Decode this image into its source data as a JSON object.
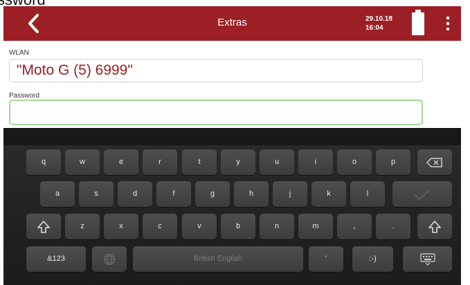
{
  "page_header_crop": "ssword",
  "appbar": {
    "title": "Extras",
    "date": "29.10.18",
    "time": "16:04",
    "background": "#9b1f24",
    "back_icon": "chevron-left-icon",
    "battery_icon": "battery-full-icon",
    "menu_icon": "more-vert-icon"
  },
  "form": {
    "wlan_label": "WLAN",
    "wlan_value": "\"Moto G (5) 6999\"",
    "password_label": "Password",
    "password_value": ""
  },
  "keyboard": {
    "row1": [
      "q",
      "w",
      "e",
      "r",
      "t",
      "y",
      "u",
      "i",
      "o",
      "p"
    ],
    "row2": [
      "a",
      "s",
      "d",
      "f",
      "g",
      "h",
      "j",
      "k",
      "l"
    ],
    "row3": [
      "z",
      "x",
      "c",
      "v",
      "b",
      "n",
      "m",
      ",",
      "."
    ],
    "row4": {
      "symbols": "&123",
      "space": "British English",
      "apostrophe": "'",
      "emoticon": ":-)"
    },
    "backspace_icon": "backspace-icon",
    "enter_icon": "checkmark-icon",
    "shift_icon": "shift-icon",
    "globe_icon": "globe-icon",
    "hide_keyboard_icon": "keyboard-hide-icon"
  }
}
